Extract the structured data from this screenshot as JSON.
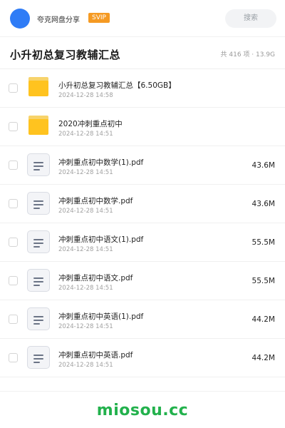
{
  "topbar": {
    "share_title": "夸克网盘分享",
    "badge": "SVIP",
    "search_label": "搜索"
  },
  "header": {
    "title": "小升初总复习教辅汇总",
    "summary": "共 416 项 · 13.9G"
  },
  "files": [
    {
      "type": "folder",
      "name": "小升初总复习教辅汇总【6.50GB】",
      "date": "2024-12-28 14:58",
      "size": ""
    },
    {
      "type": "folder",
      "name": "2020冲刺重点初中",
      "date": "2024-12-28 14:51",
      "size": ""
    },
    {
      "type": "pdf",
      "name": "冲刺重点初中数学(1).pdf",
      "date": "2024-12-28 14:51",
      "size": "43.6M"
    },
    {
      "type": "pdf",
      "name": "冲刺重点初中数学.pdf",
      "date": "2024-12-28 14:51",
      "size": "43.6M"
    },
    {
      "type": "pdf",
      "name": "冲刺重点初中语文(1).pdf",
      "date": "2024-12-28 14:51",
      "size": "55.5M"
    },
    {
      "type": "pdf",
      "name": "冲刺重点初中语文.pdf",
      "date": "2024-12-28 14:51",
      "size": "55.5M"
    },
    {
      "type": "pdf",
      "name": "冲刺重点初中英语(1).pdf",
      "date": "2024-12-28 14:51",
      "size": "44.2M"
    },
    {
      "type": "pdf",
      "name": "冲刺重点初中英语.pdf",
      "date": "2024-12-28 14:51",
      "size": "44.2M"
    }
  ],
  "watermark": "miosou.cc",
  "colors": {
    "accent": "#2f7cf6",
    "svip": "#f59a23",
    "folder": "#ffc31f",
    "watermark": "#22b14c"
  }
}
